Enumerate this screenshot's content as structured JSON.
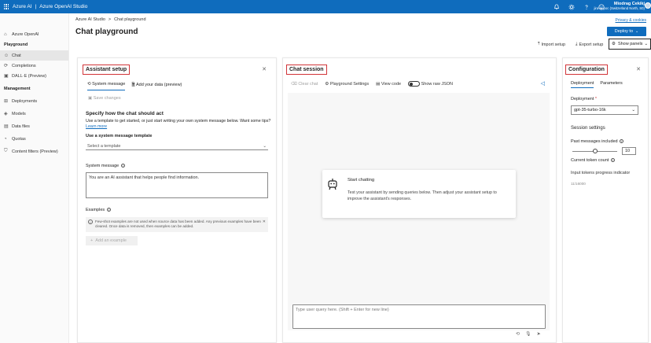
{
  "topbar": {
    "brand_left": "Azure AI",
    "brand_sep": "|",
    "brand_right": "Azure OpenAI Studio",
    "user_name": "Miodrag Cekikj",
    "user_tenant": "jira-ai-poc (Switzerland North, S0)",
    "icons": [
      "bell-icon",
      "gear-icon",
      "help-icon",
      "smiley-icon"
    ]
  },
  "sidebar": {
    "top_item": "Azure OpenAI",
    "playground_head": "Playground",
    "playground_items": [
      "Chat",
      "Completions",
      "DALL·E (Preview)"
    ],
    "management_head": "Management",
    "management_items": [
      "Deployments",
      "Models",
      "Data files",
      "Quotas",
      "Content filters (Preview)"
    ]
  },
  "header": {
    "breadcrumb_root": "Azure AI Studio",
    "breadcrumb_sep": ">",
    "breadcrumb_current": "Chat playground",
    "title": "Chat playground",
    "privacy": "Privacy & cookies",
    "deploy": "Deploy to",
    "show_panels": "Show panels",
    "import_setup": "Import setup",
    "export_setup": "Export setup"
  },
  "assistant": {
    "title": "Assistant setup",
    "tab_system": "System message",
    "tab_data": "Add your data (preview)",
    "save_changes": "Save changes",
    "specify_title": "Specify how the chat should act",
    "specify_desc": "Use a template to get started, or just start writing your own system message below. Want some tips?",
    "learn_more": "Learn more",
    "template_label": "Use a system message template",
    "template_placeholder": "Select a template",
    "system_message_label": "System message",
    "system_message_value": "You are an AI assistant that helps people find information.",
    "examples_label": "Examples",
    "examples_info": "Few-shot examples are not used when source data has been added. Any previous examples have been cleared. Once data is removed, then examples can be added.",
    "add_example": "Add an example"
  },
  "chat": {
    "title": "Chat session",
    "clear_chat": "Clear chat",
    "playground_settings": "Playground Settings",
    "view_code": "View code",
    "show_raw_json": "Show raw JSON",
    "start_title": "Start chatting",
    "start_desc": "Test your assistant by sending queries below. Then adjust your assistant setup to improve the assistant's responses.",
    "input_placeholder": "Type user query here. (Shift + Enter for new line)"
  },
  "config": {
    "title": "Configuration",
    "tab_deployment": "Deployment",
    "tab_parameters": "Parameters",
    "deployment_label": "Deployment",
    "required_mark": "*",
    "deployment_value": "gpt-35-turbo-16k",
    "session_settings": "Session settings",
    "past_messages_label": "Past messages included",
    "past_messages_value": "10",
    "past_messages_fraction": 0.5,
    "token_count_label": "Current token count",
    "token_progress_label": "Input tokens progress indicator",
    "token_count_value": "11/16000"
  },
  "colors": {
    "brand": "#0f6cbd",
    "highlight": "#d13438"
  }
}
